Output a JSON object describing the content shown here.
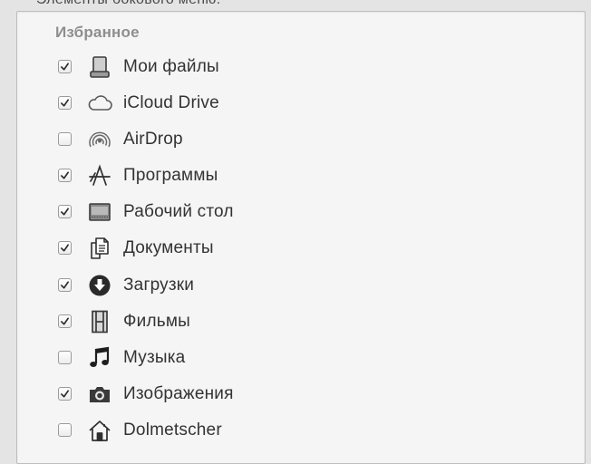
{
  "window": {
    "top_label": "Элементы бокового меню:"
  },
  "sidebar_prefs": {
    "section_title": "Избранное",
    "items": [
      {
        "label": "Мои файлы",
        "checked": true,
        "icon": "all-my-files-icon"
      },
      {
        "label": "iCloud Drive",
        "checked": true,
        "icon": "cloud-icon"
      },
      {
        "label": "AirDrop",
        "checked": false,
        "icon": "airdrop-icon"
      },
      {
        "label": "Программы",
        "checked": true,
        "icon": "applications-icon"
      },
      {
        "label": "Рабочий стол",
        "checked": true,
        "icon": "desktop-icon"
      },
      {
        "label": "Документы",
        "checked": true,
        "icon": "documents-icon"
      },
      {
        "label": "Загрузки",
        "checked": true,
        "icon": "downloads-icon"
      },
      {
        "label": "Фильмы",
        "checked": true,
        "icon": "movies-icon"
      },
      {
        "label": "Музыка",
        "checked": false,
        "icon": "music-icon"
      },
      {
        "label": "Изображения",
        "checked": true,
        "icon": "pictures-icon"
      },
      {
        "label": "Dolmetscher",
        "checked": false,
        "icon": "home-icon"
      }
    ]
  }
}
